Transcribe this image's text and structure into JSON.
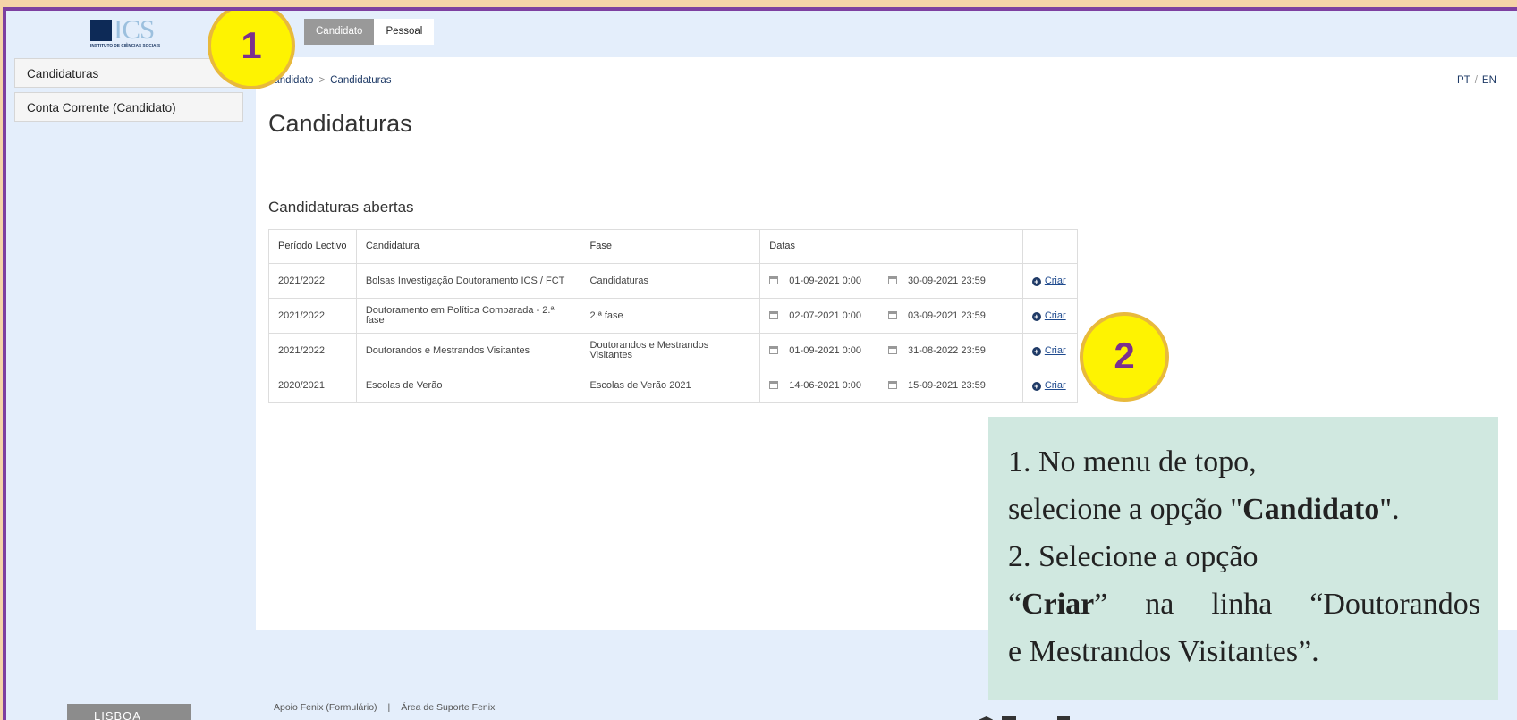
{
  "logo": {
    "text": "ICS",
    "subtitle": "INSTITUTO DE CIÊNCIAS SOCIAIS"
  },
  "topnav": {
    "items": [
      {
        "label": "Candidato",
        "active": true
      },
      {
        "label": "Pessoal",
        "active": false
      }
    ]
  },
  "sidebar": {
    "items": [
      {
        "label": "Candidaturas"
      },
      {
        "label": "Conta Corrente (Candidato)"
      }
    ]
  },
  "breadcrumb": {
    "items": [
      "Candidato",
      "Candidaturas"
    ],
    "separator": ">"
  },
  "lang": {
    "pt": "PT",
    "en": "EN",
    "separator": "/"
  },
  "page": {
    "title": "Candidaturas",
    "subtitle": "Candidaturas abertas"
  },
  "table": {
    "headers": {
      "periodo": "Período Lectivo",
      "candidatura": "Candidatura",
      "fase": "Fase",
      "datas": "Datas"
    },
    "rows": [
      {
        "periodo": "2021/2022",
        "candidatura": "Bolsas Investigação Doutoramento ICS / FCT",
        "fase": "Candidaturas",
        "inicio": "01-09-2021 0:00",
        "fim": "30-09-2021 23:59",
        "acao": "Criar"
      },
      {
        "periodo": "2021/2022",
        "candidatura": "Doutoramento em Política Comparada - 2.ª fase",
        "fase": "2.ª fase",
        "inicio": "02-07-2021 0:00",
        "fim": "03-09-2021 23:59",
        "acao": "Criar"
      },
      {
        "periodo": "2021/2022",
        "candidatura": "Doutorandos e Mestrandos Visitantes",
        "fase": "Doutorandos e Mestrandos Visitantes",
        "inicio": "01-09-2021 0:00",
        "fim": "31-08-2022 23:59",
        "acao": "Criar"
      },
      {
        "periodo": "2020/2021",
        "candidatura": "Escolas de Verão",
        "fase": "Escolas de Verão 2021",
        "inicio": "14-06-2021 0:00",
        "fim": "15-09-2021 23:59",
        "acao": "Criar"
      }
    ]
  },
  "badges": {
    "one": "1",
    "two": "2"
  },
  "note": {
    "line1": "1. No menu de topo,",
    "line2_pre": "selecione a opção \"",
    "line2_bold": "Candidato",
    "line2_post": "\".",
    "line3": "2. Selecione a opção",
    "line4_pre": "“",
    "line4_bold": "Criar",
    "line4_post": "” na linha “Doutorandos",
    "line5": "e Mestrandos Visitantes”."
  },
  "footer": {
    "link1": "Apoio Fenix (Formulário)",
    "separator": "|",
    "link2": "Área de Suporte Fenix",
    "ulisboa": "LISBOA"
  },
  "colors": {
    "frame": "#7d3fa0",
    "badge": "#fef301",
    "note_bg": "#d0e8e0",
    "active_tab": "#999999"
  }
}
